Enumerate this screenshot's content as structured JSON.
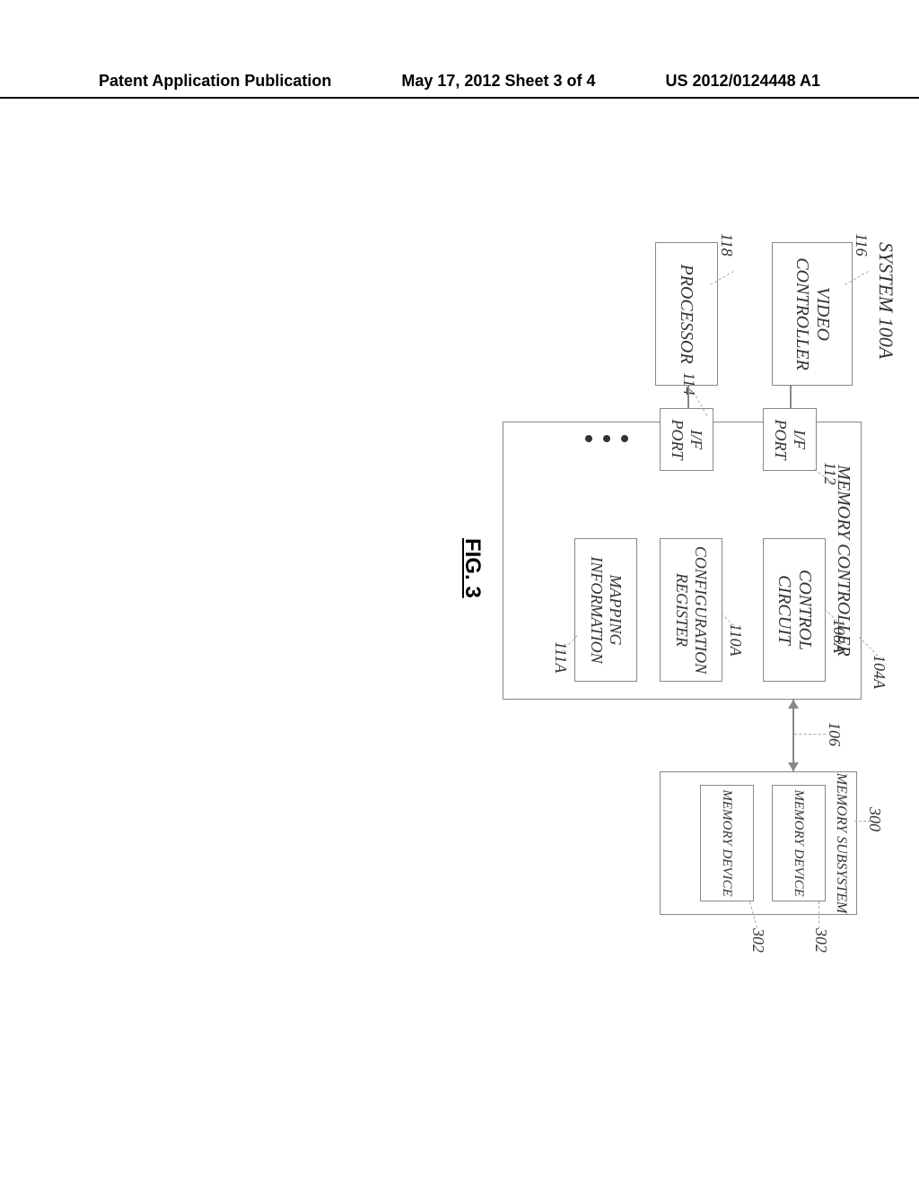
{
  "header": {
    "left": "Patent Application Publication",
    "center": "May 17, 2012   Sheet 3 of 4",
    "right": "US 2012/0124448 A1"
  },
  "diagram": {
    "system_label": "SYSTEM 100A",
    "video_controller": "VIDEO\nCONTROLLER",
    "processor": "PROCESSOR",
    "memory_controller": "MEMORY CONTROLLER",
    "if_port1": "I/F\nPORT",
    "if_port2": "I/F\nPORT",
    "control_circuit": "CONTROL\nCIRCUIT",
    "config_register": "CONFIGURATION\nREGISTER",
    "mapping_info": "MAPPING\nINFORMATION",
    "memory_subsystem": "MEMORY SUBSYSTEM",
    "memory_device1": "MEMORY DEVICE",
    "memory_device2": "MEMORY DEVICE",
    "ref_116": "116",
    "ref_118": "118",
    "ref_112": "112",
    "ref_114": "114",
    "ref_104A": "104A",
    "ref_108A": "108A",
    "ref_110A": "110A",
    "ref_111A": "111A",
    "ref_106": "106",
    "ref_300": "300",
    "ref_302a": "302",
    "ref_302b": "302",
    "figure_label": "FIG. 3"
  }
}
